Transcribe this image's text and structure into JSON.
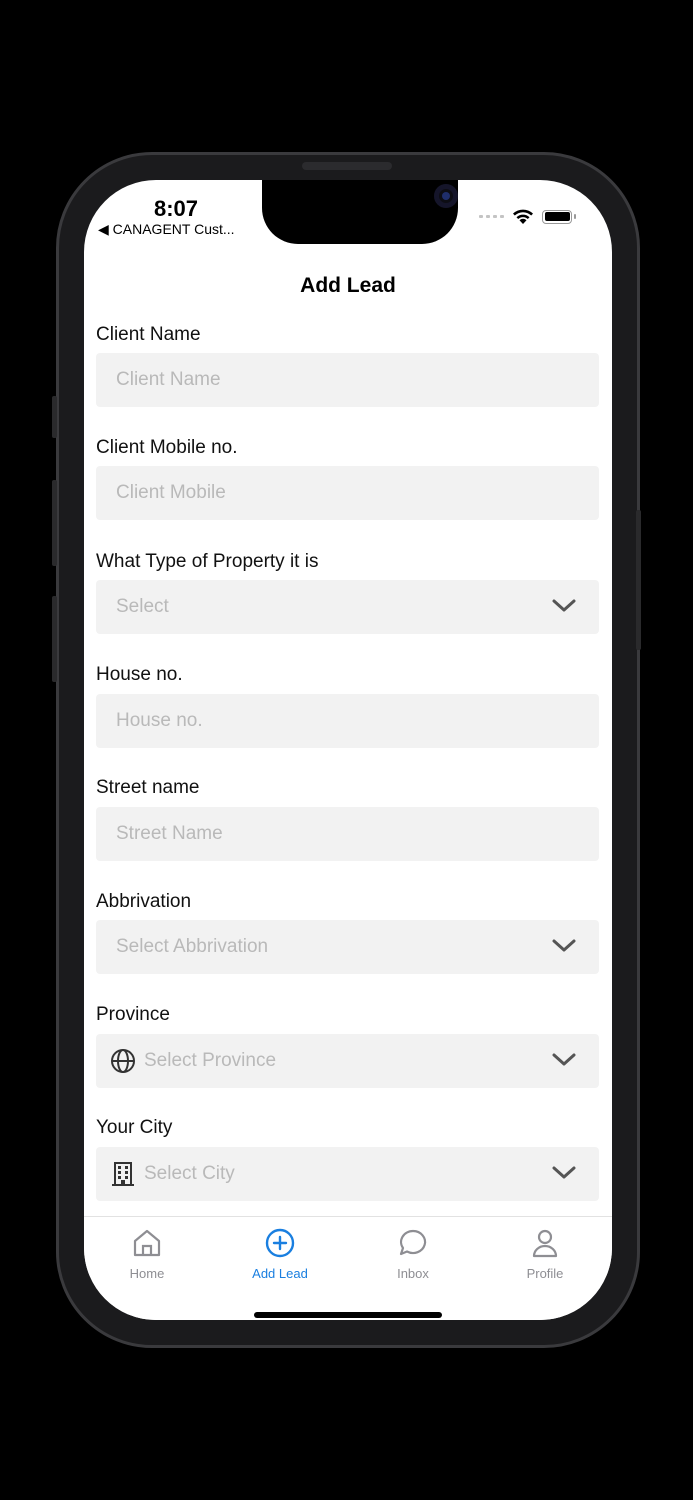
{
  "status_bar": {
    "time": "8:07",
    "back_app": "◀ CANAGENT Cust..."
  },
  "header": {
    "title": "Add Lead"
  },
  "form": {
    "client_name": {
      "label": "Client Name",
      "placeholder": "Client Name"
    },
    "client_mobile": {
      "label": "Client Mobile no.",
      "placeholder": "Client Mobile"
    },
    "property_type": {
      "label": "What Type of Property it is",
      "placeholder": "Select"
    },
    "house_no": {
      "label": "House no.",
      "placeholder": "House no."
    },
    "street_name": {
      "label": "Street name",
      "placeholder": "Street Name"
    },
    "abbrivation": {
      "label": "Abbrivation",
      "placeholder": "Select Abbrivation"
    },
    "province": {
      "label": "Province",
      "placeholder": "Select Province",
      "icon": "globe-icon"
    },
    "city": {
      "label": "Your City",
      "placeholder": "Select City",
      "icon": "building-icon"
    }
  },
  "tabbar": {
    "items": [
      {
        "label": "Home",
        "icon": "home-icon",
        "active": false
      },
      {
        "label": "Add Lead",
        "icon": "add-circle-icon",
        "active": true
      },
      {
        "label": "Inbox",
        "icon": "chat-bubble-icon",
        "active": false
      },
      {
        "label": "Profile",
        "icon": "person-icon",
        "active": false
      }
    ]
  },
  "colors": {
    "accent": "#1a7fe0",
    "field_bg": "#f2f2f2",
    "placeholder": "#b9b9b9",
    "inactive_tab": "#8e8e93"
  }
}
